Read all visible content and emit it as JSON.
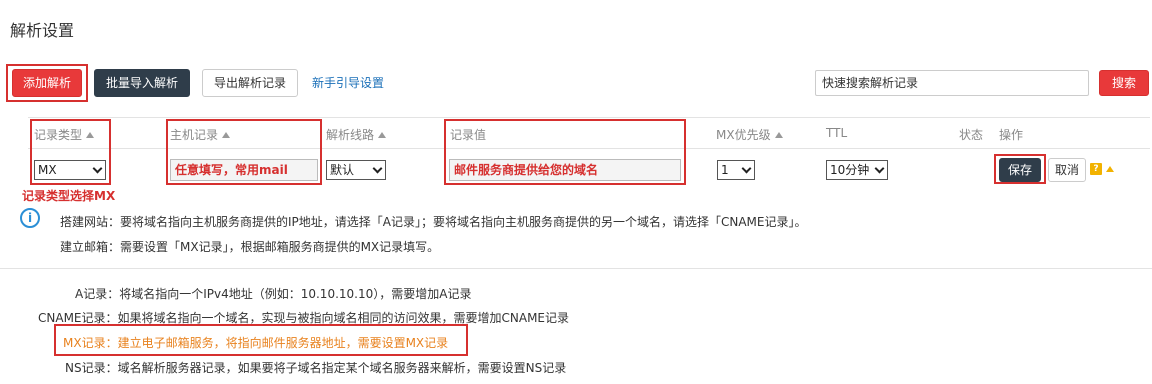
{
  "page": {
    "title": "解析设置"
  },
  "toolbar": {
    "add_label": "添加解析",
    "batch_import_label": "批量导入解析",
    "export_label": "导出解析记录",
    "guide_link": "新手引导设置",
    "search_placeholder": "快速搜索解析记录",
    "search_button": "搜索"
  },
  "table": {
    "headers": {
      "record_type": "记录类型",
      "host": "主机记录",
      "line": "解析线路",
      "value": "记录值",
      "mx_priority": "MX优先级",
      "ttl": "TTL",
      "status": "状态",
      "actions": "操作"
    },
    "edit_row": {
      "record_type": "MX",
      "host_hint": "任意填写，常用mail",
      "line": "默认",
      "value_hint": "邮件服务商提供给您的域名",
      "mx_priority": "1",
      "ttl": "10分钟",
      "save": "保存",
      "cancel": "取消"
    }
  },
  "annotations": {
    "record_type_hint": "记录类型选择MX"
  },
  "info": {
    "line1": "搭建网站：要将域名指向主机服务商提供的IP地址，请选择「A记录」；要将域名指向主机服务商提供的另一个域名，请选择「CNAME记录」。",
    "line2": "建立邮箱：需要设置「MX记录」，根据邮箱服务商提供的MX记录填写。"
  },
  "records_help": {
    "a": "A记录：将域名指向一个IPv4地址（例如：10.10.10.10），需要增加A记录",
    "cname": "CNAME记录：如果将域名指向一个域名，实现与被指向域名相同的访问效果，需要增加CNAME记录",
    "mx": "MX记录：建立电子邮箱服务，将指向邮件服务器地址，需要设置MX记录",
    "ns": "NS记录：域名解析服务器记录，如果要将子域名指定某个域名服务器来解析，需要设置NS记录"
  },
  "colors": {
    "accent_red": "#e8393a",
    "dark_button": "#2f3d4a",
    "link_blue": "#1a6fb8",
    "highlight_orange": "#e8821e",
    "annotation_red": "#d6302f"
  }
}
